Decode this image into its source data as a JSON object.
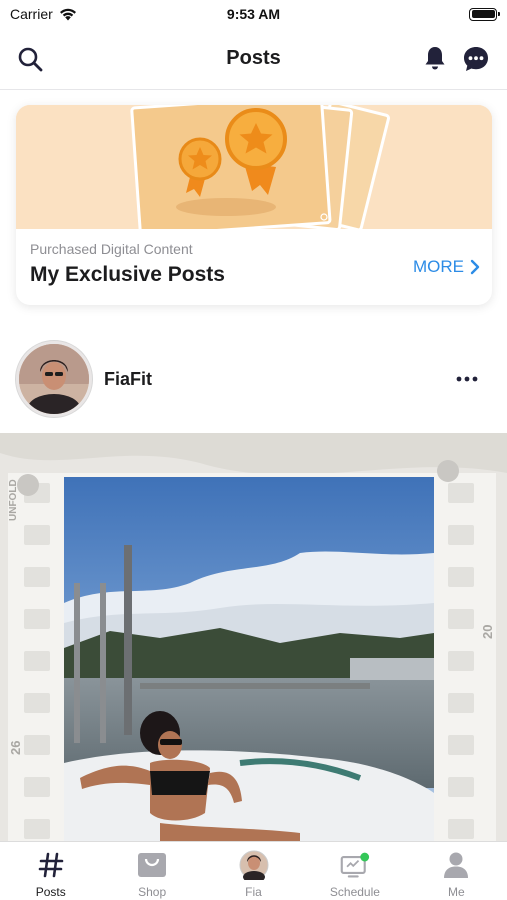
{
  "status_bar": {
    "carrier": "Carrier",
    "time": "9:53 AM"
  },
  "nav": {
    "title": "Posts"
  },
  "exclusive_card": {
    "subtitle": "Purchased Digital Content",
    "title": "My Exclusive Posts",
    "more_label": "MORE"
  },
  "post": {
    "username": "FiaFit",
    "film_brand": "UNFOLD",
    "frame_number_left": "26",
    "frame_number_right": "20"
  },
  "tabs": [
    {
      "label": "Posts",
      "icon": "hashtag-icon",
      "active": true
    },
    {
      "label": "Shop",
      "icon": "shopping-bag-icon",
      "active": false
    },
    {
      "label": "Fia",
      "icon": "avatar-icon",
      "active": false
    },
    {
      "label": "Schedule",
      "icon": "schedule-icon",
      "active": false
    },
    {
      "label": "Me",
      "icon": "person-icon",
      "active": false
    }
  ],
  "colors": {
    "accent": "#2d8ce6",
    "card_banner": "#fbe1c2",
    "online_badge": "#34c759"
  }
}
